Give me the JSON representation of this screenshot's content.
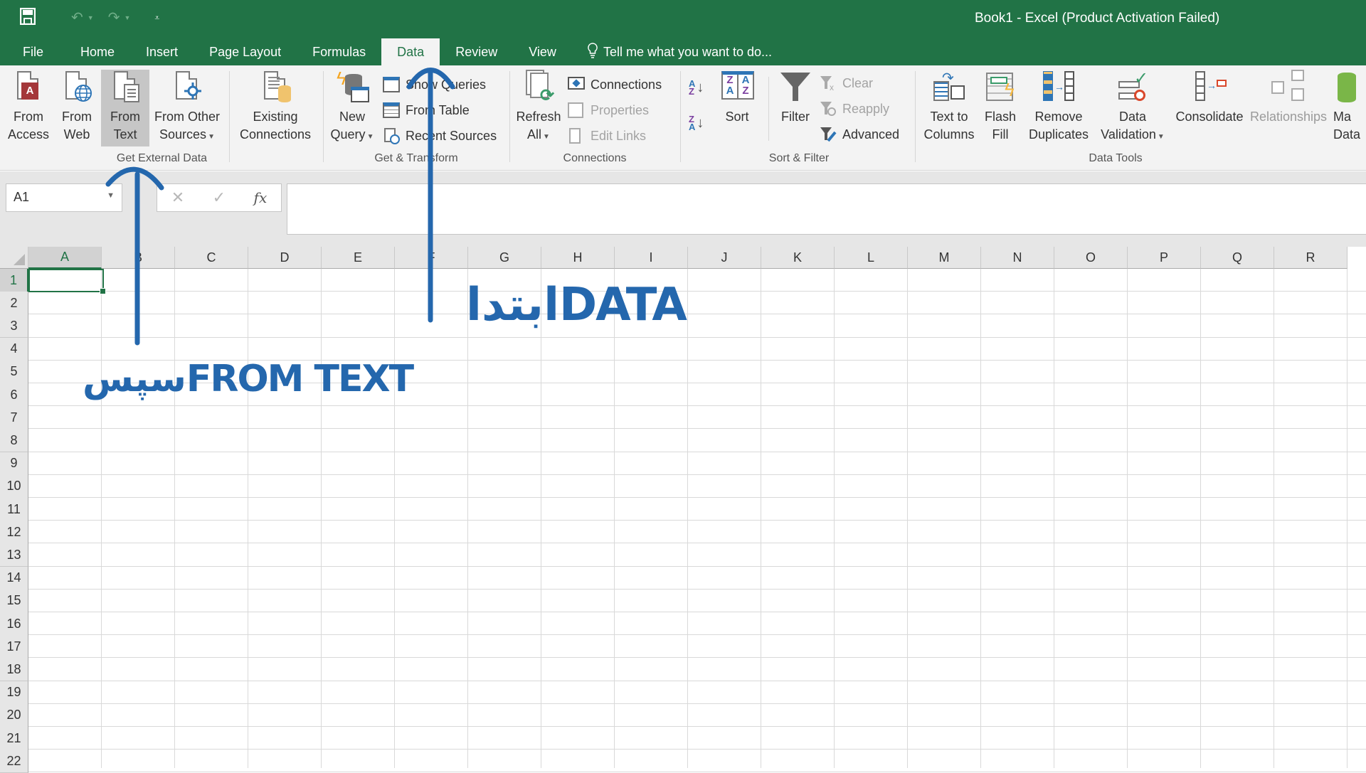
{
  "window": {
    "title": "Book1 - Excel (Product Activation Failed)"
  },
  "quick_access": {
    "save_icon": "save-icon",
    "undo_icon": "undo-icon",
    "redo_icon": "redo-icon",
    "customize_icon": "customize-toolbar-icon"
  },
  "tabs": [
    {
      "label": "File"
    },
    {
      "label": "Home"
    },
    {
      "label": "Insert"
    },
    {
      "label": "Page Layout"
    },
    {
      "label": "Formulas"
    },
    {
      "label": "Data",
      "active": true
    },
    {
      "label": "Review"
    },
    {
      "label": "View"
    }
  ],
  "tell_me": {
    "placeholder": "Tell me what you want to do..."
  },
  "ribbon": {
    "get_external_data": {
      "label": "Get External Data",
      "from_access": [
        "From",
        "Access"
      ],
      "from_web": [
        "From",
        "Web"
      ],
      "from_text": [
        "From",
        "Text"
      ],
      "from_other_sources": [
        "From Other",
        "Sources"
      ],
      "existing_connections": [
        "Existing",
        "Connections"
      ]
    },
    "get_transform": {
      "label": "Get & Transform",
      "new_query": [
        "New",
        "Query"
      ],
      "show_queries": "Show Queries",
      "from_table": "From Table",
      "recent_sources": "Recent Sources"
    },
    "connections": {
      "label": "Connections",
      "refresh_all": [
        "Refresh",
        "All"
      ],
      "connections": "Connections",
      "properties": "Properties",
      "edit_links": "Edit Links"
    },
    "sort_filter": {
      "label": "Sort & Filter",
      "sort_az": "A→Z",
      "sort_za": "Z→A",
      "sort": "Sort",
      "filter": "Filter",
      "clear": "Clear",
      "reapply": "Reapply",
      "advanced": "Advanced"
    },
    "data_tools": {
      "label": "Data Tools",
      "text_to_columns": [
        "Text to",
        "Columns"
      ],
      "flash_fill": [
        "Flash",
        "Fill"
      ],
      "remove_duplicates": [
        "Remove",
        "Duplicates"
      ],
      "data_validation": [
        "Data",
        "Validation"
      ],
      "consolidate": "Consolidate",
      "relationships": "Relationships",
      "manage_data_model": [
        "Ma",
        "Data"
      ]
    }
  },
  "formula_bar": {
    "name_box": "A1",
    "cancel_icon": "✕",
    "enter_icon": "✓",
    "fx_label": "fx",
    "formula_value": ""
  },
  "sheet": {
    "columns": [
      "A",
      "B",
      "C",
      "D",
      "E",
      "F",
      "G",
      "H",
      "I",
      "J",
      "K",
      "L",
      "M",
      "N",
      "O",
      "P",
      "Q",
      "R"
    ],
    "rows": [
      "1",
      "2",
      "3",
      "4",
      "5",
      "6",
      "7",
      "8",
      "9",
      "10",
      "11",
      "12",
      "13",
      "14",
      "15",
      "16",
      "17",
      "18",
      "19",
      "20",
      "21",
      "22"
    ],
    "active_cell": "A1"
  },
  "annotations": {
    "first_step": "ابتداDATA",
    "second_step": "سپسFROM TEXT",
    "color": "#2467ad"
  }
}
